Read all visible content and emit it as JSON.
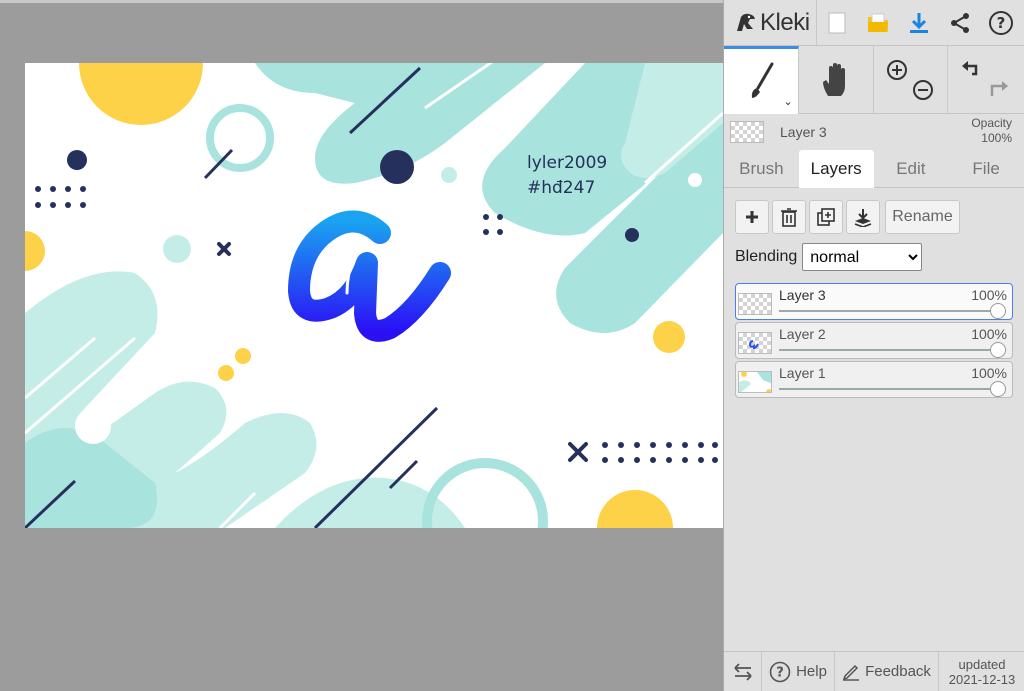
{
  "app": {
    "logo_text": "Kleki"
  },
  "toolbar": {
    "icons": [
      "new-file-icon",
      "open-file-icon",
      "download-icon",
      "share-icon",
      "help-icon"
    ],
    "accent_color": "#3c8ce6"
  },
  "tools": {
    "active": "brush",
    "items": [
      "brush-icon",
      "hand-icon",
      "zoom-icon",
      "undo-redo-icon"
    ]
  },
  "current_layer": {
    "name": "Layer 3",
    "opacity_label": "Opacity",
    "opacity_value": "100%"
  },
  "tabs": [
    {
      "label": "Brush",
      "active": false
    },
    {
      "label": "Layers",
      "active": true
    },
    {
      "label": "Edit",
      "active": false
    },
    {
      "label": "File",
      "active": false
    }
  ],
  "layer_actions": {
    "rename_label": "Rename"
  },
  "blending": {
    "label": "Blending",
    "value": "normal"
  },
  "layers": [
    {
      "name": "Layer 3",
      "opacity": "100%",
      "level": 1.0,
      "selected": true
    },
    {
      "name": "Layer 2",
      "opacity": "100%",
      "level": 1.0,
      "selected": false
    },
    {
      "name": "Layer 1",
      "opacity": "100%",
      "level": 1.0,
      "selected": false
    }
  ],
  "footer": {
    "help_label": "Help",
    "feedback_label": "Feedback",
    "updated_label": "updated",
    "updated_date": "2021-12-13"
  },
  "canvas": {
    "text_line1": "lyler2009",
    "text_line2": "#hđ247",
    "colors": {
      "mint": "#a8e3dd",
      "mint_light": "#c4ede8",
      "yellow": "#fdd148",
      "navy": "#26305d",
      "blue_top": "#1aa3f0",
      "blue_bottom": "#2a10f5"
    }
  }
}
